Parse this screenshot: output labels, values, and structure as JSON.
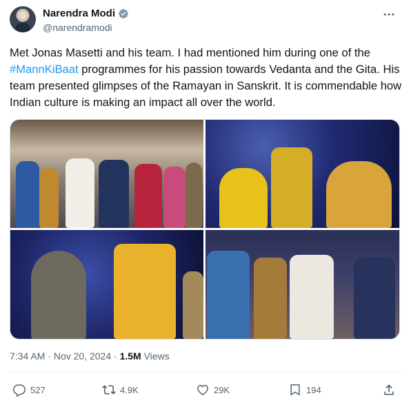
{
  "author": {
    "name": "Narendra Modi",
    "handle": "@narendramodi",
    "avatar_icon": "profile-photo",
    "verified_icon": "verified-badge-icon",
    "verified_color": "#829aab"
  },
  "tweet": {
    "text_before": "Met Jonas Masetti and his team. I had mentioned him during one of the ",
    "hashtag": "#MannKiBaat",
    "text_after": " programmes for his passion towards Vedanta and the Gita. His team presented glimpses of the Ramayan in Sanskrit. It is commendable how Indian culture is making an impact all over the world.",
    "hashtag_color": "#1d9bf0"
  },
  "media": {
    "photos": [
      "group-photo-on-stage",
      "performers-starry-backdrop",
      "costumed-performers",
      "greeting-with-namaste"
    ]
  },
  "meta": {
    "time": "7:34 AM",
    "dot1": " · ",
    "date": "Nov 20, 2024",
    "dot2": " · ",
    "views_count": "1.5M",
    "views_label": " Views"
  },
  "actions": {
    "replies": "527",
    "reposts": "4.9K",
    "likes": "29K",
    "bookmarks": "194"
  },
  "icons": {
    "more": "more-options-icon",
    "reply": "reply-icon",
    "repost": "repost-icon",
    "like": "heart-icon",
    "bookmark": "bookmark-icon",
    "share": "share-icon"
  }
}
